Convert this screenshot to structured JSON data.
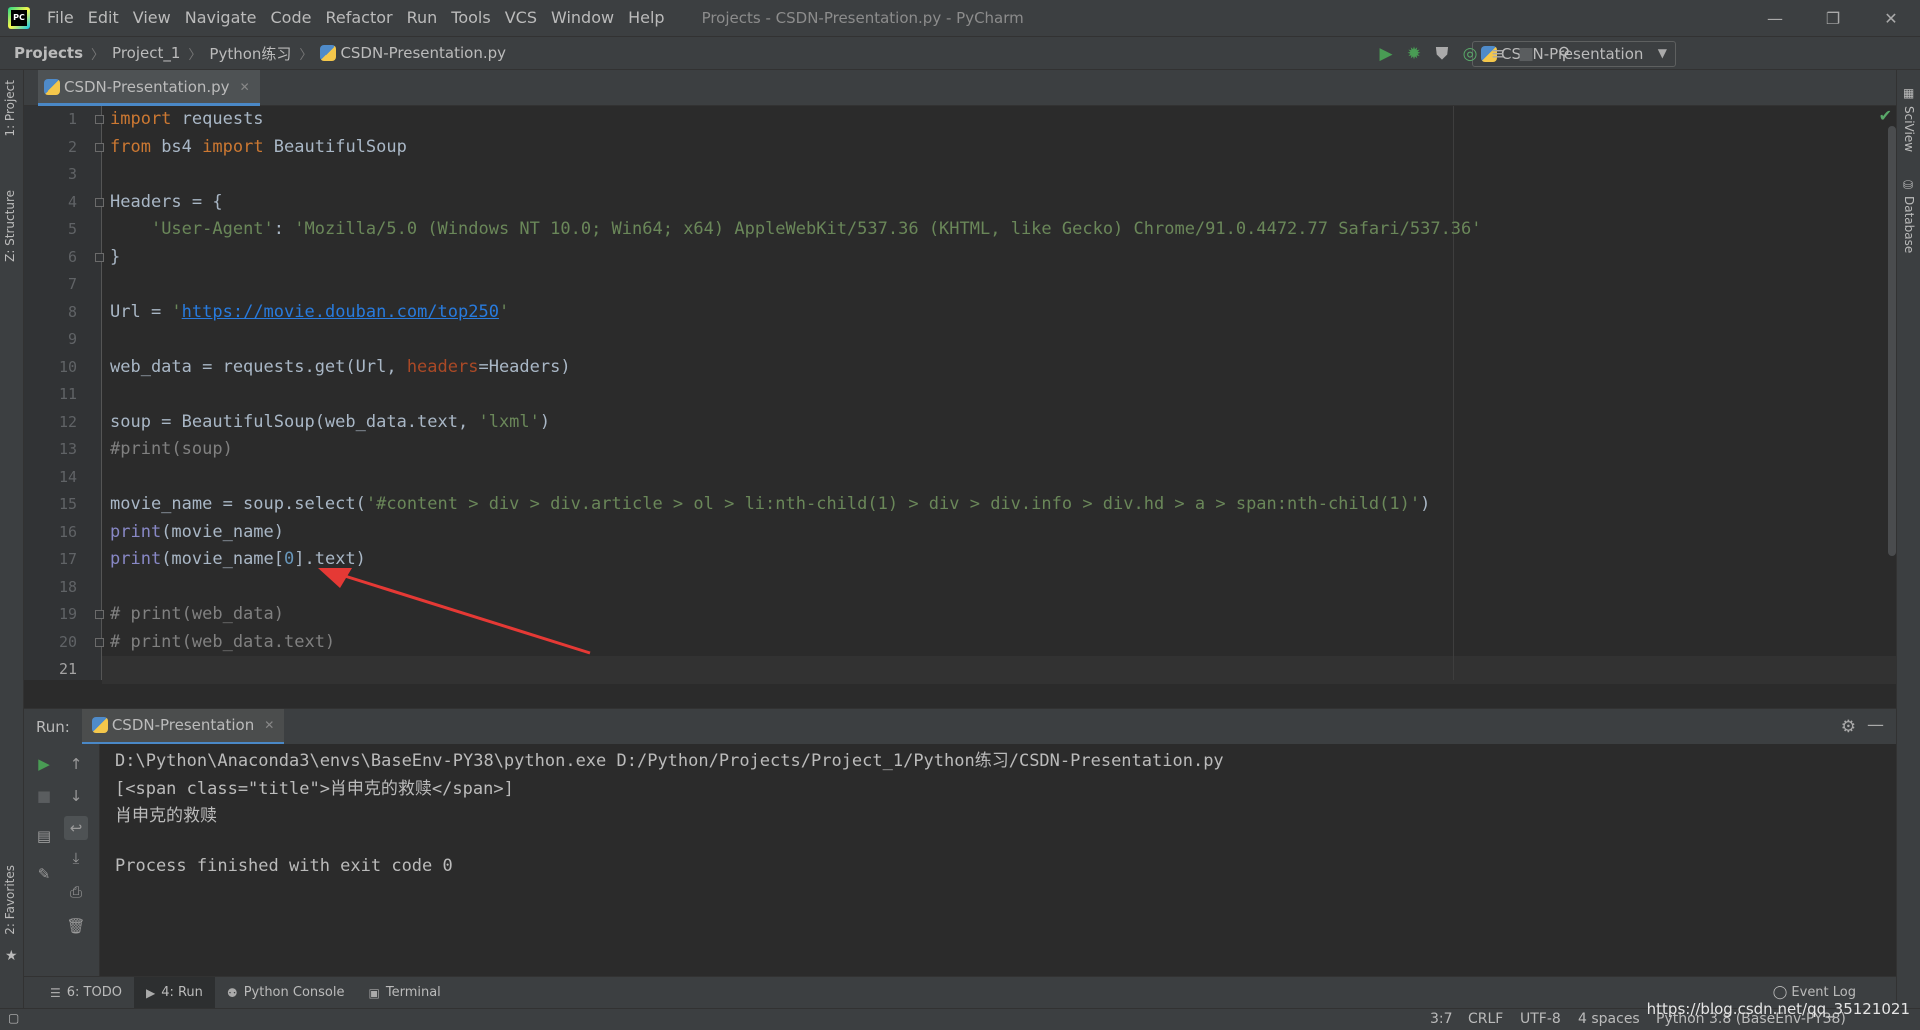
{
  "window": {
    "title": "Projects - CSDN-Presentation.py - PyCharm",
    "minimize": "—",
    "restore": "❐",
    "close": "✕"
  },
  "menu": [
    "File",
    "Edit",
    "View",
    "Navigate",
    "Code",
    "Refactor",
    "Run",
    "Tools",
    "VCS",
    "Window",
    "Help"
  ],
  "breadcrumb": [
    "Projects",
    "Project_1",
    "Python练习",
    "CSDN-Presentation.py"
  ],
  "run_config": {
    "name": "CSDN-Presentation"
  },
  "left_tabs": [
    "1: Project",
    "Z: Structure",
    "2: Favorites"
  ],
  "right_tabs": [
    "SciView",
    "Database"
  ],
  "editor": {
    "tab": "CSDN-Presentation.py",
    "current_line": 21,
    "line_numbers": [
      "1",
      "2",
      "3",
      "4",
      "5",
      "6",
      "7",
      "8",
      "9",
      "10",
      "11",
      "12",
      "13",
      "14",
      "15",
      "16",
      "17",
      "18",
      "19",
      "20",
      "21"
    ]
  },
  "run": {
    "label": "Run:",
    "tab": "CSDN-Presentation",
    "output": [
      "D:\\Python\\Anaconda3\\envs\\BaseEnv-PY38\\python.exe D:/Python/Projects/Project_1/Python练习/CSDN-Presentation.py",
      "[<span class=\"title\">肖申克的救赎</span>]",
      "肖申克的救赎",
      "",
      "Process finished with exit code 0"
    ]
  },
  "bottom_tabs": [
    {
      "label": "6: TODO",
      "icon": "list-icon"
    },
    {
      "label": "4: Run",
      "icon": "run-icon"
    },
    {
      "label": "Python Console",
      "icon": "python-icon"
    },
    {
      "label": "Terminal",
      "icon": "terminal-icon"
    }
  ],
  "event_log": "Event Log",
  "status": {
    "position": "3:7",
    "line_sep": "CRLF",
    "encoding": "UTF-8",
    "indent": "4 spaces",
    "interpreter": "Python 3.8 (BaseEnv-PY38)",
    "watermark": "https://blog.csdn.net/qq_35121021"
  },
  "colors": {
    "keyword": "#cc7832",
    "string": "#6a8759",
    "comment": "#808080",
    "annotation_arrow": "#e53935"
  }
}
